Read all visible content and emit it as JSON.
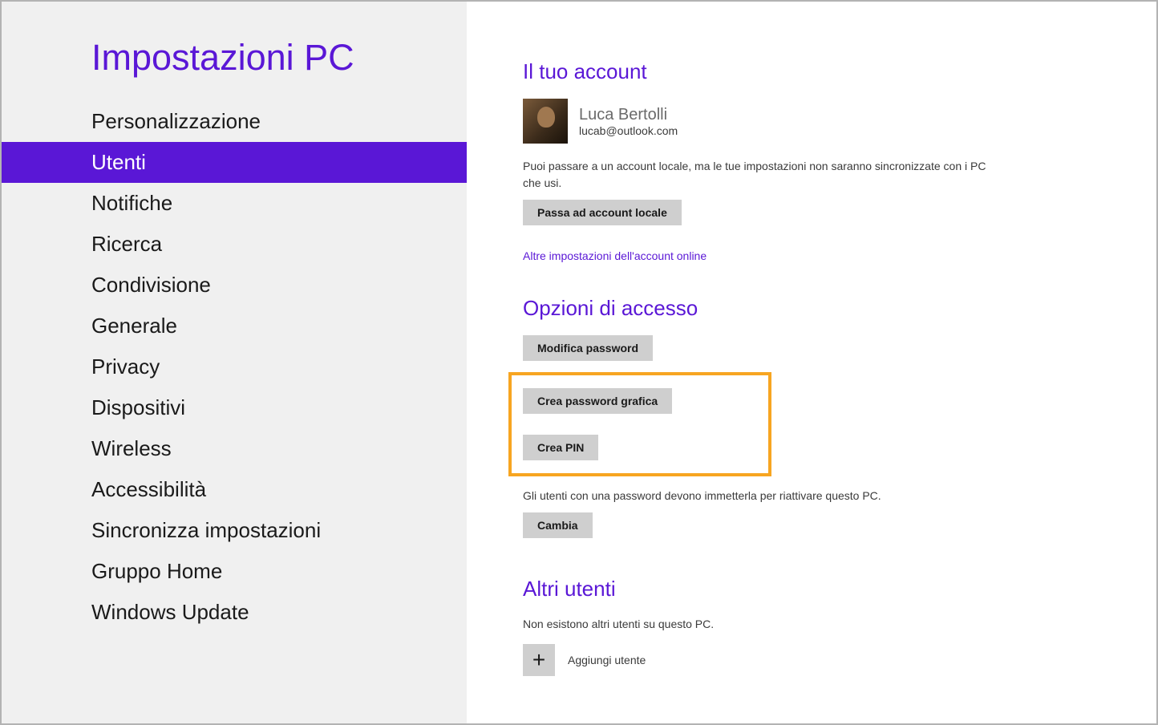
{
  "sidebar": {
    "title": "Impostazioni PC",
    "items": [
      {
        "label": "Personalizzazione",
        "active": false
      },
      {
        "label": "Utenti",
        "active": true
      },
      {
        "label": "Notifiche",
        "active": false
      },
      {
        "label": "Ricerca",
        "active": false
      },
      {
        "label": "Condivisione",
        "active": false
      },
      {
        "label": "Generale",
        "active": false
      },
      {
        "label": "Privacy",
        "active": false
      },
      {
        "label": "Dispositivi",
        "active": false
      },
      {
        "label": "Wireless",
        "active": false
      },
      {
        "label": "Accessibilità",
        "active": false
      },
      {
        "label": "Sincronizza impostazioni",
        "active": false
      },
      {
        "label": "Gruppo Home",
        "active": false
      },
      {
        "label": "Windows Update",
        "active": false
      }
    ]
  },
  "account": {
    "section_title": "Il tuo account",
    "name": "Luca Bertolli",
    "email": "lucab@outlook.com",
    "desc": "Puoi passare a un account locale, ma le tue impostazioni non saranno sincronizzate con i PC che usi.",
    "switch_button": "Passa ad account locale",
    "online_link": "Altre impostazioni dell'account online"
  },
  "signin": {
    "section_title": "Opzioni di accesso",
    "change_password": "Modifica password",
    "picture_password": "Crea password grafica",
    "create_pin": "Crea PIN",
    "wake_text": "Gli utenti con una password devono immetterla per riattivare questo PC.",
    "change_button": "Cambia"
  },
  "other_users": {
    "section_title": "Altri utenti",
    "none_text": "Non esistono altri utenti su questo PC.",
    "add_label": "Aggiungi utente",
    "plus": "+"
  }
}
